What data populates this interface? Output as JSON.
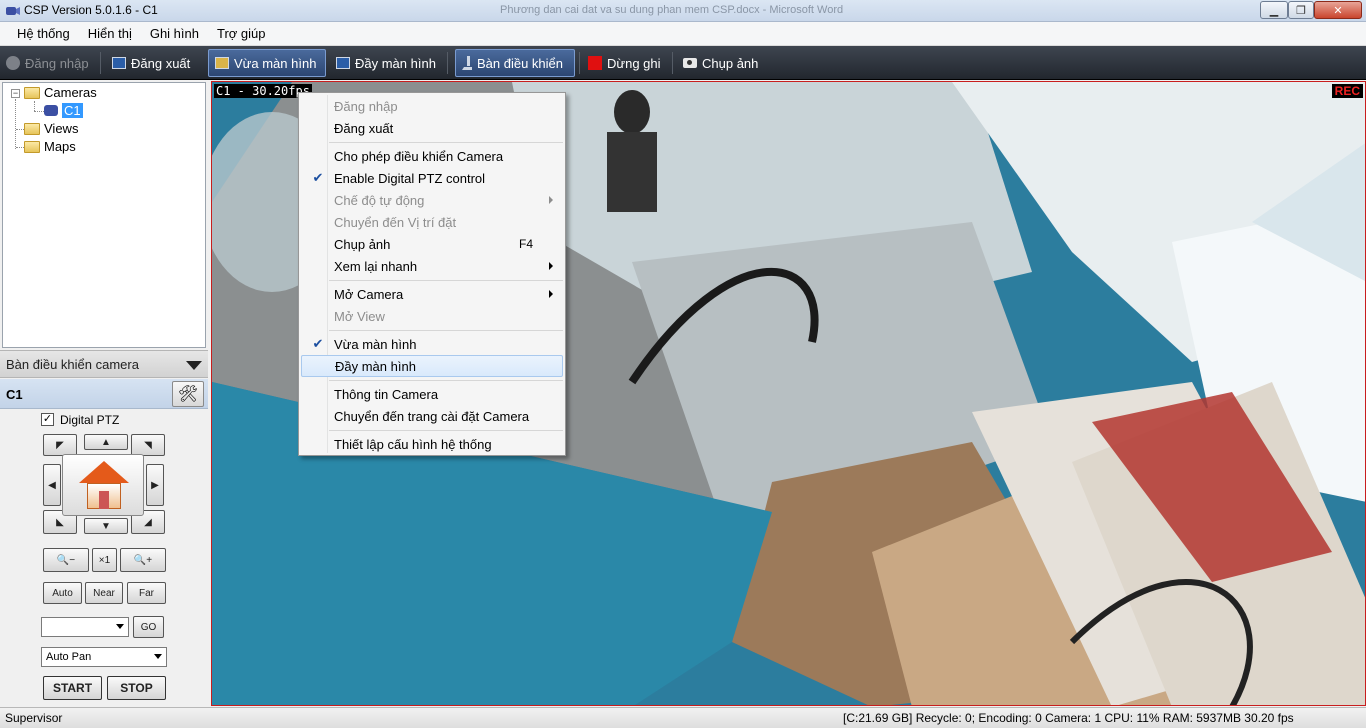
{
  "window": {
    "title": "CSP Version 5.0.1.6 - C1",
    "background_title": "Phương dan cai dat va su dung phan mem CSP.docx - Microsoft Word"
  },
  "menubar": {
    "items": [
      "Hệ thống",
      "Hiển thị",
      "Ghi hình",
      "Trợ giúp"
    ]
  },
  "toolbar": {
    "login": "Đăng nhập",
    "logout": "Đăng xuất",
    "fit_screen": "Vừa màn hình",
    "full_screen": "Đầy màn hình",
    "control_panel": "Bàn điều khiển",
    "stop_record": "Dừng ghi",
    "snapshot": "Chụp ảnh"
  },
  "tree": {
    "cameras": "Cameras",
    "camera_c1": "C1",
    "views": "Views",
    "maps": "Maps"
  },
  "camera_panel": {
    "title": "Bàn điều khiển camera",
    "camera_name": "C1",
    "digital_ptz_label": "Digital PTZ",
    "digital_ptz_checked": true,
    "zoom_reset": "×1",
    "focus_auto": "Auto",
    "focus_near": "Near",
    "focus_far": "Far",
    "preset_value": "",
    "go": "GO",
    "pattern_value": "Auto Pan",
    "start": "START",
    "stop": "STOP"
  },
  "video": {
    "overlay": "C1 - 30.20fps",
    "rec": "REC"
  },
  "context_menu": {
    "login": "Đăng nhập",
    "logout": "Đăng xuất",
    "allow_control": "Cho phép điều khiển Camera",
    "enable_dptz": "Enable Digital PTZ control",
    "auto_mode": "Chế độ tự động",
    "goto_preset": "Chuyển đến Vị trí đặt",
    "snapshot": "Chụp ảnh",
    "snapshot_shortcut": "F4",
    "quick_review": "Xem lại nhanh",
    "open_camera": "Mở Camera",
    "open_view": "Mở View",
    "fit_screen": "Vừa màn hình",
    "full_screen": "Đầy màn hình",
    "camera_info": "Thông tin Camera",
    "goto_camera_settings": "Chuyển đến trang cài đặt Camera",
    "system_config": "Thiết lập cấu hình hệ thống"
  },
  "statusbar": {
    "user": "Supervisor",
    "info": "[C:21.69 GB]  Recycle: 0;  Encoding: 0   Camera: 1   CPU: 11%   RAM: 5937MB   30.20 fps"
  },
  "colors": {
    "toolbar_bg": "#2b3038",
    "accent": "#3399ff",
    "rec": "#e22222"
  }
}
